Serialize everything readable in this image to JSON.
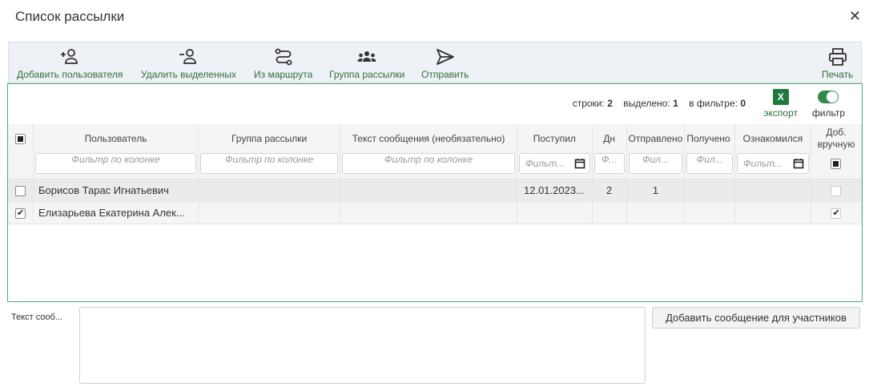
{
  "window": {
    "title": "Список рассылки"
  },
  "toolbar": {
    "add_user": "Добавить пользователя",
    "delete_selected": "Удалить выделенных",
    "from_route": "Из маршрута",
    "mailing_group": "Группа рассылки",
    "send": "Отправить",
    "print": "Печать"
  },
  "stats": {
    "rows_label": "строки:",
    "rows_value": "2",
    "selected_label": "выделено:",
    "selected_value": "1",
    "filtered_label": "в фильтре:",
    "filtered_value": "0"
  },
  "export": {
    "icon_text": "X",
    "label": "экспорт"
  },
  "filter_toggle": {
    "label": "фильтр",
    "on": true
  },
  "columns": [
    {
      "header": "Пользователь",
      "filter": "Фильтр по колонке"
    },
    {
      "header": "Группа рассылки",
      "filter": "Фильтр по колонке"
    },
    {
      "header": "Текст сообщения (необязательно)",
      "filter": "Фильтр по колонке"
    },
    {
      "header": "Поступил",
      "filter": "Фильт..."
    },
    {
      "header": "Дн",
      "filter": "Ф..."
    },
    {
      "header": "Отправлено",
      "filter": "Фил..."
    },
    {
      "header": "Получено",
      "filter": "Фил..."
    },
    {
      "header": "Ознакомился",
      "filter": "Фильт..."
    },
    {
      "header_line1": "Доб.",
      "header_line2": "вручную"
    }
  ],
  "rows": [
    {
      "selected": false,
      "user": "Борисов Тарас Игнатьевич",
      "group": "",
      "text": "",
      "received": "12.01.2023...",
      "days": "2",
      "sent": "1",
      "got": "",
      "read": "",
      "manual": false
    },
    {
      "selected": true,
      "user": "Елизарьева Екатерина Алек...",
      "group": "",
      "text": "",
      "received": "",
      "days": "",
      "sent": "",
      "got": "",
      "read": "",
      "manual": true
    }
  ],
  "message": {
    "label": "Текст сооб...",
    "value": ""
  },
  "add_message_button": "Добавить сообщение для участников",
  "colors": {
    "accent": "#2f8a49",
    "border": "#4caf6f",
    "excel": "#1e7a3c"
  }
}
